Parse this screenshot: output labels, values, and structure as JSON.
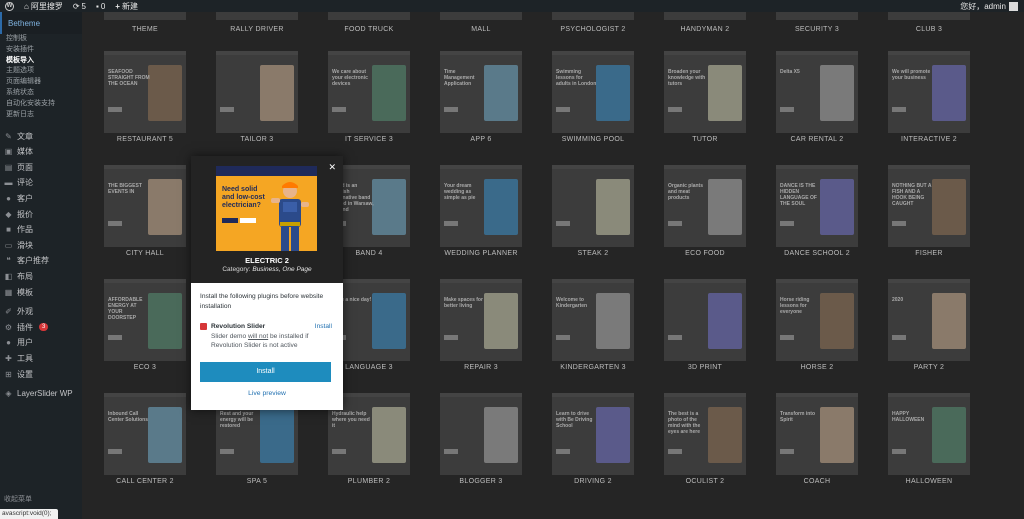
{
  "admin_bar": {
    "site_name": "阿里搜罗",
    "updates_count": "5",
    "comments_count": "0",
    "new_label": "新建",
    "greeting": "您好，admin"
  },
  "sidebar": {
    "active_label": "Betheme",
    "submenu": [
      "控制板",
      "安装插件",
      "模板导入",
      "主题选项",
      "页面编辑器",
      "系统状态",
      "自动化安装支持",
      "更新日志"
    ],
    "submenu_current_index": 2,
    "menu": [
      {
        "label": "文章",
        "icon": "pin-icon"
      },
      {
        "label": "媒体",
        "icon": "media-icon"
      },
      {
        "label": "页面",
        "icon": "page-icon"
      },
      {
        "label": "评论",
        "icon": "comment-icon"
      },
      {
        "label": "客户",
        "icon": "user-icon"
      },
      {
        "label": "报价",
        "icon": "tag-icon"
      },
      {
        "label": "作品",
        "icon": "portfolio-icon"
      },
      {
        "label": "滑块",
        "icon": "slider-icon"
      },
      {
        "label": "客户推荐",
        "icon": "quote-icon"
      },
      {
        "label": "布局",
        "icon": "layout-icon"
      },
      {
        "label": "模板",
        "icon": "template-icon"
      },
      {
        "label": "外观",
        "icon": "brush-icon"
      },
      {
        "label": "插件",
        "icon": "plugin-icon",
        "badge": "3"
      },
      {
        "label": "用户",
        "icon": "users-icon"
      },
      {
        "label": "工具",
        "icon": "tools-icon"
      },
      {
        "label": "设置",
        "icon": "settings-icon"
      },
      {
        "label": "LayerSlider WP",
        "icon": "layers-icon"
      }
    ],
    "bottom_label": "收起菜单"
  },
  "grid": {
    "top_row_labels": [
      "THEME",
      "RALLY DRIVER",
      "FOOD TRUCK",
      "MALL",
      "PSYCHOLOGIST 2",
      "HANDYMAN 2",
      "SECURITY 3",
      "CLUB 3"
    ],
    "rows": [
      [
        "RESTAURANT 5",
        "TAILOR 3",
        "IT SERVICE 3",
        "APP 6",
        "SWIMMING POOL",
        "TUTOR",
        "CAR RENTAL 2",
        "INTERACTIVE 2"
      ],
      [
        "CITY HALL",
        "",
        "BAND 4",
        "WEDDING PLANNER",
        "STEAK 2",
        "ECO FOOD",
        "DANCE SCHOOL 2",
        "FISHER"
      ],
      [
        "ECO 3",
        "",
        "LANGUAGE 3",
        "REPAIR 3",
        "KINDERGARTEN 3",
        "3D PRINT",
        "HORSE 2",
        "PARTY 2"
      ],
      [
        "CALL CENTER 2",
        "SPA 5",
        "PLUMBER 2",
        "BLOGGER 3",
        "DRIVING 2",
        "OCULIST 2",
        "COACH",
        "HALLOWEEN"
      ]
    ],
    "thumb_texts": {
      "0": [
        "SEAFOOD STRAIGHT FROM THE OCEAN",
        "",
        "We care about your electronic devices",
        "Time Management Application",
        "Swimming lessons for adults in London",
        "Broaden your knowledge with tutors",
        "Delta X5",
        "We will promote your business"
      ],
      "1": [
        "THE BIGGEST EVENTS IN",
        "",
        "Band is an english alternative band based in Warsaw, Poland",
        "Your dream wedding as simple as pie",
        "",
        "Organic plants and meat products",
        "DANCE IS THE HIDDEN LANGUAGE OF THE SOUL",
        "NOTHING BUT A FISH AND A HOOK BEING CAUGHT"
      ],
      "2": [
        "AFFORDABLE ENERGY AT YOUR DOORSTEP",
        "",
        "Have a nice day!",
        "Make spaces for better living",
        "Welcome to Kindergarten",
        "",
        "Horse riding lessons for everyone",
        "2020"
      ],
      "3": [
        "Inbound Call Center Solutions",
        "Rest and your energy will be restored",
        "Hydraulic help where you need it",
        "",
        "Learn to drive with Be Driving School",
        "The best is a photo of the mind with the eyes are here",
        "Transform into Spirit",
        "HAPPY HALLOWEEN"
      ]
    }
  },
  "modal": {
    "preview_heading": "Need solid and low-cost electrician?",
    "title": "ELECTRIC 2",
    "category_label": "Category:",
    "category_value": "Business, One Page",
    "body_text": "Install the following plugins before website installation",
    "plugin_name": "Revolution Slider",
    "plugin_action": "Install",
    "note_part1": "Slider demo ",
    "note_underline": "will not",
    "note_part2": " be installed if Revolution Slider is not active",
    "install_label": "Install",
    "live_preview_label": "Live preview",
    "close_icon": "close-icon",
    "colors": {
      "accent": "#1e8cbe",
      "preview_bg": "#f5a623",
      "preview_navy": "#1f2a5a"
    }
  },
  "status_bar": {
    "text": "avascript:void(0);"
  }
}
